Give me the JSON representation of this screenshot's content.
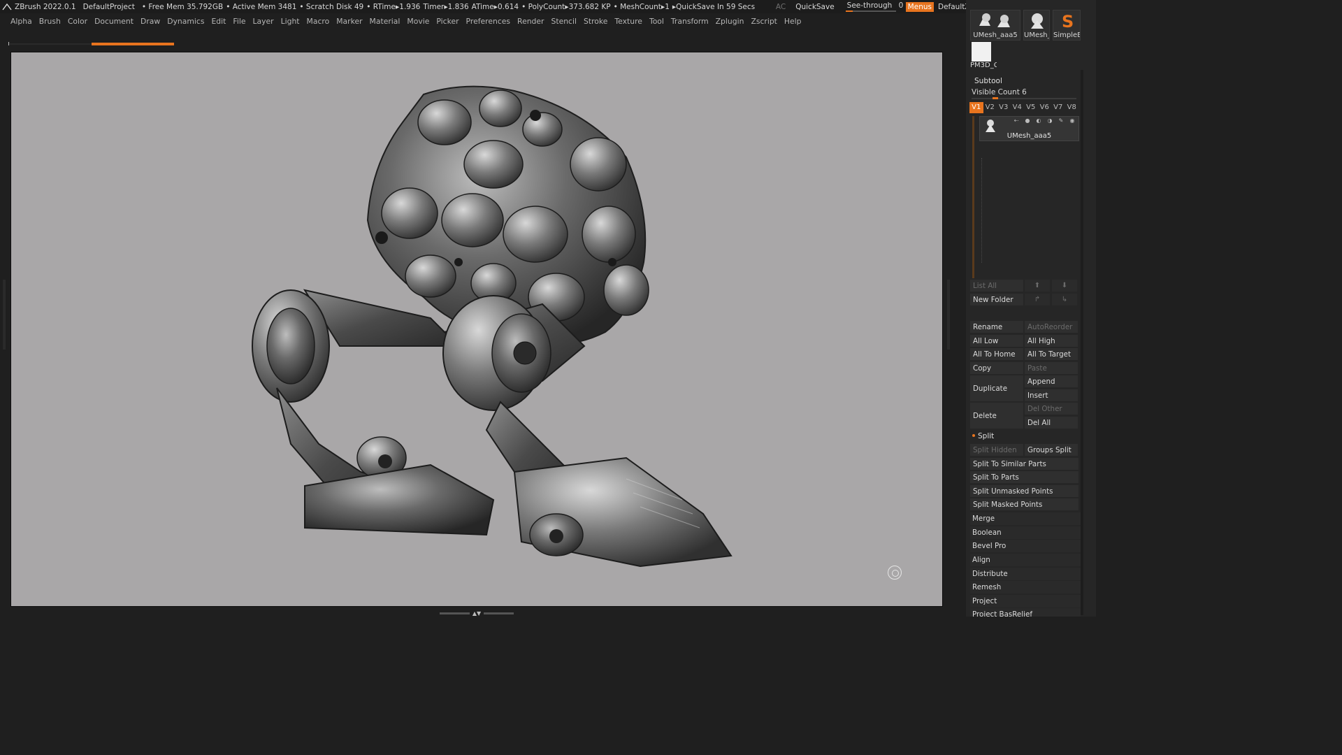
{
  "statusbar": {
    "app": "ZBrush 2022.0.1",
    "project": "DefaultProject",
    "free_mem": "• Free Mem 35.792GB",
    "active_mem": "• Active Mem 3481",
    "scratch_disk": "• Scratch Disk 49",
    "rtime": "• RTime▸1.936",
    "timer": "Timer▸1.836",
    "atime": "ATime▸0.614",
    "polycount": "• PolyCount▸373.682 KP",
    "meshcount": "• MeshCount▸1",
    "quicksave_timer": "▸QuickSave In 59 Secs",
    "ac": "AC",
    "quicksave": "QuickSave",
    "seethrough_label": "See-through",
    "seethrough_value": "0",
    "menus": "Menus",
    "default_zscript": "DefaultZScript"
  },
  "menubar": [
    "Alpha",
    "Brush",
    "Color",
    "Document",
    "Draw",
    "Dynamics",
    "Edit",
    "File",
    "Layer",
    "Light",
    "Macro",
    "Marker",
    "Material",
    "Movie",
    "Picker",
    "Preferences",
    "Render",
    "Stencil",
    "Stroke",
    "Texture",
    "Tool",
    "Transform",
    "Zplugin",
    "Zscript",
    "Help"
  ],
  "progress": {
    "fraction": 0.5
  },
  "tool_thumbs": {
    "t1": "UMesh_aaa5",
    "t2": "UMesh_",
    "t3": "SimpleB",
    "t4": "PM3D_C"
  },
  "subtool": {
    "header": "Subtool",
    "visible_count": "Visible Count 6",
    "versions": [
      "V1",
      "V2",
      "V3",
      "V4",
      "V5",
      "V6",
      "V7",
      "V8"
    ],
    "active_version": "V1",
    "item_name": "UMesh_aaa5",
    "list_all": "List All",
    "new_folder": "New Folder",
    "rename": "Rename",
    "auto_reorder": "AutoReorder",
    "all_low": "All Low",
    "all_high": "All High",
    "all_to_home": "All To Home",
    "all_to_target": "All To Target",
    "copy": "Copy",
    "paste": "Paste",
    "duplicate": "Duplicate",
    "append": "Append",
    "insert": "Insert",
    "delete": "Delete",
    "del_other": "Del Other",
    "del_all": "Del All",
    "split": "Split",
    "split_hidden": "Split Hidden",
    "groups_split": "Groups Split",
    "split_similar": "Split To Similar Parts",
    "split_parts": "Split To Parts",
    "split_unmasked": "Split Unmasked Points",
    "split_masked": "Split Masked Points",
    "sections": [
      "Merge",
      "Boolean",
      "Bevel Pro",
      "Align",
      "Distribute",
      "Remesh",
      "Project",
      "Project BasRelief"
    ]
  },
  "colors": {
    "accent": "#e8741e",
    "canvas_bg": "#a9a7a8",
    "ui_bg": "#1f1f1f"
  },
  "icons": [
    "zbrush-logo-icon",
    "quicksave-icon",
    "window-minimize-icon",
    "window-restore-icon",
    "window-close-icon",
    "gyro-icon",
    "eye-icon",
    "brush-icon",
    "arrow-up-icon",
    "arrow-down-icon"
  ]
}
